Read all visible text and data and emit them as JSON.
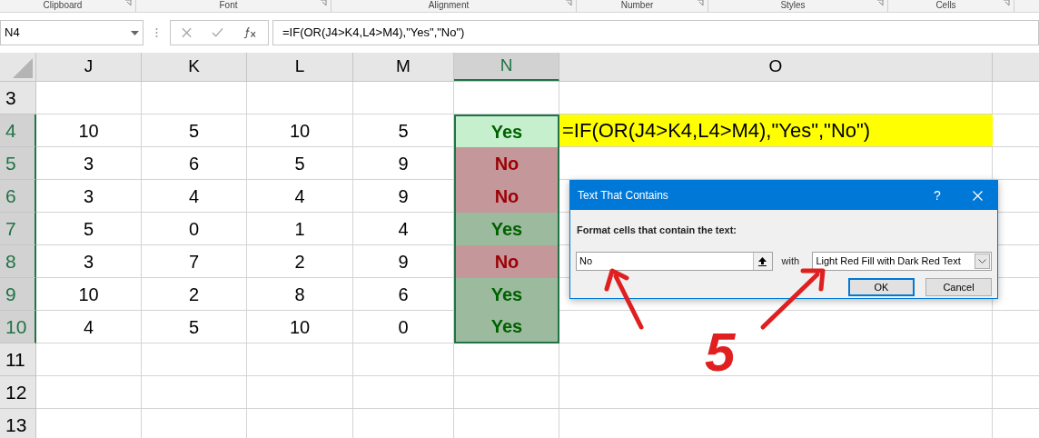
{
  "ribbon_groups": [
    "Clipboard",
    "Font",
    "Alignment",
    "Number",
    "Styles",
    "Cells"
  ],
  "name_box": {
    "value": "N4"
  },
  "formula_bar": {
    "value": "=IF(OR(J4>K4,L4>M4),\"Yes\",\"No\")"
  },
  "columns": [
    {
      "label": "J",
      "selected": false
    },
    {
      "label": "K",
      "selected": false
    },
    {
      "label": "L",
      "selected": false
    },
    {
      "label": "M",
      "selected": false
    },
    {
      "label": "N",
      "selected": true
    },
    {
      "label": "O",
      "selected": false
    }
  ],
  "rows": [
    {
      "label": "3",
      "selected": false
    },
    {
      "label": "4",
      "selected": true,
      "values": [
        "10",
        "5",
        "10",
        "5"
      ],
      "result": {
        "value": "Yes",
        "kind": "good",
        "active": true
      },
      "note": "=IF(OR(J4>K4,L4>M4),\"Yes\",\"No\")"
    },
    {
      "label": "5",
      "selected": true,
      "values": [
        "3",
        "6",
        "5",
        "9"
      ],
      "result": {
        "value": "No",
        "kind": "bad",
        "active": false
      }
    },
    {
      "label": "6",
      "selected": true,
      "values": [
        "3",
        "4",
        "4",
        "9"
      ],
      "result": {
        "value": "No",
        "kind": "bad",
        "active": false
      }
    },
    {
      "label": "7",
      "selected": true,
      "values": [
        "5",
        "0",
        "1",
        "4"
      ],
      "result": {
        "value": "Yes",
        "kind": "good",
        "active": false
      }
    },
    {
      "label": "8",
      "selected": true,
      "values": [
        "3",
        "7",
        "2",
        "9"
      ],
      "result": {
        "value": "No",
        "kind": "bad",
        "active": false
      }
    },
    {
      "label": "9",
      "selected": true,
      "values": [
        "10",
        "2",
        "8",
        "6"
      ],
      "result": {
        "value": "Yes",
        "kind": "good",
        "active": false
      }
    },
    {
      "label": "10",
      "selected": true,
      "values": [
        "4",
        "5",
        "10",
        "0"
      ],
      "result": {
        "value": "Yes",
        "kind": "good",
        "active": false
      }
    },
    {
      "label": "11",
      "selected": false
    },
    {
      "label": "12",
      "selected": false
    },
    {
      "label": "13",
      "selected": false
    }
  ],
  "dialog": {
    "title": "Text That Contains",
    "help": "?",
    "prompt": "Format cells that contain the text:",
    "text_value": "No",
    "with_label": "with",
    "format": "Light Red Fill with Dark Red Text",
    "buttons": [
      "OK",
      "Cancel"
    ]
  },
  "annotation": {
    "text": "5"
  }
}
